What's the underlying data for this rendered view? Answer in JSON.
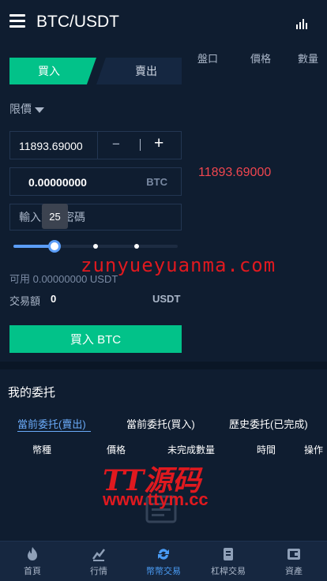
{
  "header": {
    "title": "BTC/USDT"
  },
  "orderbook": {
    "col_depth": "盤口",
    "col_price": "價格",
    "col_qty": "數量",
    "last_price": "11893.69000"
  },
  "trade": {
    "tab_buy": "買入",
    "tab_sell": "賣出",
    "order_type": "限價",
    "price": "11893.69000",
    "minus": "−",
    "plus": "+",
    "amount": "0.00000000",
    "amount_unit": "BTC",
    "password_placeholder": "輸入交易密碼",
    "slider_tooltip": "25",
    "slider_percent": 25,
    "available": "可用 0.00000000 USDT",
    "volume_label": "交易額",
    "volume_value": "0",
    "volume_unit": "USDT",
    "buy_button": "買入 BTC"
  },
  "orders": {
    "title": "我的委托",
    "tabs": [
      "當前委托(賣出)",
      "當前委托(買入)",
      "歷史委托(已完成)"
    ],
    "active_tab": 0,
    "columns": [
      "幣種",
      "價格",
      "未完成數量",
      "時間",
      "操作"
    ]
  },
  "nav": {
    "items": [
      {
        "label": "首頁",
        "icon": "flame-icon"
      },
      {
        "label": "行情",
        "icon": "market-icon"
      },
      {
        "label": "幣幣交易",
        "icon": "exchange-icon"
      },
      {
        "label": "杠桿交易",
        "icon": "leverage-icon"
      },
      {
        "label": "資產",
        "icon": "wallet-icon"
      }
    ],
    "active": 2
  },
  "watermarks": {
    "site1": "zunyueyuanma.com",
    "brand": "TT源码",
    "site2": "www.ttym.cc"
  },
  "colors": {
    "buy_green": "#02c289",
    "sell_red": "#f0464f",
    "accent_blue": "#4a9cf5",
    "background": "#0f1d30"
  }
}
